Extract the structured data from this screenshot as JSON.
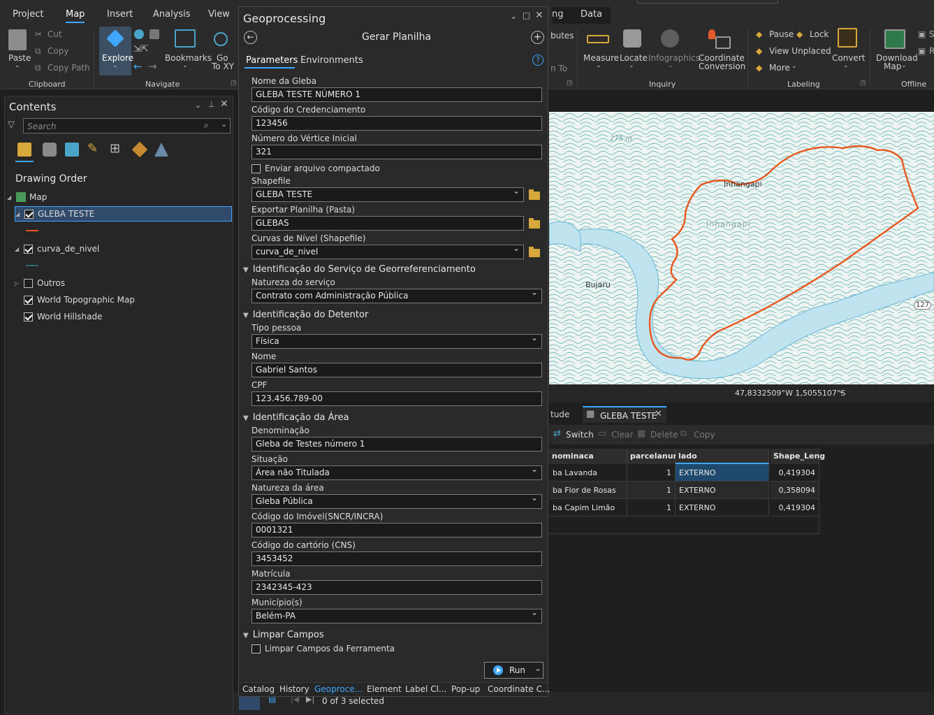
{
  "menu": {
    "tabs": [
      "Project",
      "Map",
      "Insert",
      "Analysis",
      "View",
      "Data"
    ]
  },
  "ribbon": {
    "paste": "Paste",
    "cut": "Cut",
    "copy": "Copy",
    "copy_path": "Copy Path",
    "clipboard": "Clipboard",
    "explore": "Explore",
    "bookmarks": "Bookmarks",
    "go_to_xy_1": "Go",
    "go_to_xy_2": "To XY",
    "navigate": "Navigate",
    "attributes_partial": "butes",
    "zoom_to_partial": "n To",
    "measure": "Measure",
    "locate": "Locate",
    "infographics": "Infographics",
    "coordinate_1": "Coordinate",
    "coordinate_2": "Conversion",
    "inquiry": "Inquiry",
    "pause": "Pause",
    "lock": "Lock",
    "view_unplaced": "View Unplaced",
    "more": "More",
    "convert": "Convert",
    "labeling": "Labeling",
    "download_1": "Download",
    "download_2": "Map",
    "offline": "Offline",
    "right_s1": "S",
    "right_s2": "R"
  },
  "contents": {
    "title": "Contents",
    "search_placeholder": "Search",
    "drawing_order": "Drawing Order",
    "layers": {
      "map": "Map",
      "gleba": "GLEBA TESTE",
      "curva": "curva_de_nivel",
      "outros": "Outros",
      "topo": "World Topographic Map",
      "hillshade": "World Hillshade"
    }
  },
  "geoprocessing": {
    "title": "Geoprocessing",
    "tool": "Gerar Planilha",
    "tab_params": "Parameters",
    "tab_env": "Environments",
    "f_nome_gleba": "Nome da Gleba",
    "v_nome_gleba": "GLEBA TESTE NÚMERO 1",
    "f_cod_cred": "Código do Credenciamento",
    "v_cod_cred": "123456",
    "f_num_vert": "Número do Vértice Inicial",
    "v_num_vert": "321",
    "f_zip": "Enviar arquivo compactado",
    "f_shapefile": "Shapefile",
    "v_shapefile": "GLEBA TESTE",
    "f_export": "Exportar Planilha (Pasta)",
    "v_export": "GLEBAS",
    "f_curvas": "Curvas de Nível (Shapefile)",
    "v_curvas": "curva_de_nivel",
    "s_servico": "Identificação do Serviço de Georreferenciamento",
    "f_natureza_serv": "Natureza do serviço",
    "v_natureza_serv": "Contrato com Administração Pública",
    "s_detentor": "Identificação do Detentor",
    "f_tipo": "Tipo pessoa",
    "v_tipo": "Física",
    "f_nome": "Nome",
    "v_nome": "Gabriel Santos",
    "f_cpf": "CPF",
    "v_cpf": "123.456.789-00",
    "s_area": "Identificação da Área",
    "f_denom": "Denominação",
    "v_denom": "Gleba de Testes número 1",
    "f_situacao": "Situação",
    "v_situacao": "Área não Titulada",
    "f_nat_area": "Natureza da área",
    "v_nat_area": "Gleba Pública",
    "f_cod_imovel": "Código do Imóvel(SNCR/INCRA)",
    "v_cod_imovel": "0001321",
    "f_cns": "Código do cartório (CNS)",
    "v_cns": "3453452",
    "f_matricula": "Matrícula",
    "v_matricula": "2342345-423",
    "f_municipio": "Município(s)",
    "v_municipio": "Belém-PA",
    "s_limpar": "Limpar Campos",
    "f_limpar": "Limpar Campos da Ferramenta",
    "run": "Run",
    "bottom_tabs": [
      "Catalog",
      "History",
      "Geoproce...",
      "Element",
      "Label Cl...",
      "Pop-up",
      "Coordinate C..."
    ]
  },
  "map": {
    "label_275": "275 m",
    "label_inhangapi1": "Inhangapi",
    "label_inhangapi2": "Inhangapi",
    "label_bujaru": "Bujaru",
    "label_127": "127",
    "coords": "47,8332509°W 1,5055107°S"
  },
  "table": {
    "tab_partial": "tude",
    "tab_name": "GLEBA TESTE",
    "switch": "Switch",
    "clear": "Clear",
    "delete": "Delete",
    "copy": "Copy",
    "columns": [
      "nominaca",
      "parcelanum",
      "lado",
      "Shape_Leng"
    ],
    "rows": [
      [
        "ba Lavanda",
        "1",
        "EXTERNO",
        "0,419304"
      ],
      [
        "ba Flor de Rosas",
        "1",
        "EXTERNO",
        "0,358094"
      ],
      [
        "ba Capim Limão",
        "1",
        "EXTERNO",
        "0,419304"
      ]
    ],
    "selected": "0 of 3 selected"
  }
}
